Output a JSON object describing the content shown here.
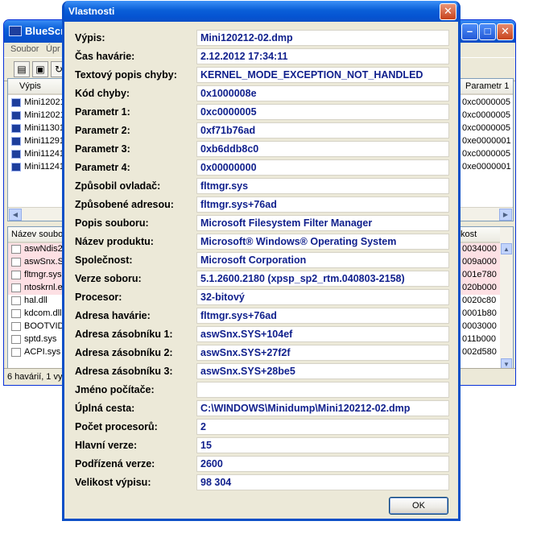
{
  "background_window": {
    "title": "BlueScr",
    "menu": [
      "Soubor",
      "Úpr"
    ],
    "top_list": {
      "header_left": "Výpis",
      "header_right": "Parametr 1",
      "rows": [
        {
          "name": "Mini12021",
          "param": "0xc0000005"
        },
        {
          "name": "Mini12021",
          "param": "0xc0000005"
        },
        {
          "name": "Mini11301",
          "param": "0xc0000005"
        },
        {
          "name": "Mini11291",
          "param": "0xe0000001"
        },
        {
          "name": "Mini11241",
          "param": "0xc0000005"
        },
        {
          "name": "Mini11241",
          "param": "0xe0000001"
        }
      ]
    },
    "bottom_list": {
      "header_left": "Název soubo",
      "header_right": "kost",
      "rows": [
        {
          "name": "aswNdis2",
          "addr": "0034000",
          "highlight": true
        },
        {
          "name": "aswSnx.S",
          "addr": "009a000",
          "highlight": true
        },
        {
          "name": "fltmgr.sys",
          "addr": "001e780",
          "highlight": true
        },
        {
          "name": "ntoskrnl.e",
          "addr": "020b000",
          "highlight": true
        },
        {
          "name": "hal.dll",
          "addr": "0020c80",
          "highlight": false
        },
        {
          "name": "kdcom.dll",
          "addr": "0001b80",
          "highlight": false
        },
        {
          "name": "BOOTVID",
          "addr": "0003000",
          "highlight": false
        },
        {
          "name": "sptd.sys",
          "addr": "011b000",
          "highlight": false
        },
        {
          "name": "ACPI.sys",
          "addr": "002d580",
          "highlight": false
        }
      ]
    },
    "status_text": "6 havárií, 1 vy"
  },
  "dialog": {
    "title": "Vlastnosti",
    "close_glyph": "✕",
    "ok_label": "OK",
    "properties": [
      {
        "label": "Výpis:",
        "value": "Mini120212-02.dmp"
      },
      {
        "label": "Čas havárie:",
        "value": "2.12.2012 17:34:11"
      },
      {
        "label": "Textový popis chyby:",
        "value": "KERNEL_MODE_EXCEPTION_NOT_HANDLED"
      },
      {
        "label": "Kód chyby:",
        "value": "0x1000008e"
      },
      {
        "label": "Parametr 1:",
        "value": "0xc0000005"
      },
      {
        "label": "Parametr 2:",
        "value": "0xf71b76ad"
      },
      {
        "label": "Parametr 3:",
        "value": "0xb6ddb8c0"
      },
      {
        "label": "Parametr 4:",
        "value": "0x00000000"
      },
      {
        "label": "Způsobil ovladač:",
        "value": "fltmgr.sys"
      },
      {
        "label": "Způsobené adresou:",
        "value": "fltmgr.sys+76ad"
      },
      {
        "label": "Popis souboru:",
        "value": "Microsoft Filesystem Filter Manager"
      },
      {
        "label": "Název produktu:",
        "value": "Microsoft® Windows® Operating System"
      },
      {
        "label": "Společnost:",
        "value": "Microsoft Corporation"
      },
      {
        "label": "Verze soboru:",
        "value": "5.1.2600.2180 (xpsp_sp2_rtm.040803-2158)"
      },
      {
        "label": "Procesor:",
        "value": "32-bitový"
      },
      {
        "label": "Adresa havárie:",
        "value": "fltmgr.sys+76ad"
      },
      {
        "label": "Adresa zásobníku 1:",
        "value": "aswSnx.SYS+104ef"
      },
      {
        "label": "Adresa zásobníku 2:",
        "value": "aswSnx.SYS+27f2f"
      },
      {
        "label": "Adresa zásobníku 3:",
        "value": "aswSnx.SYS+28be5"
      },
      {
        "label": "Jméno počítače:",
        "value": ""
      },
      {
        "label": "Úplná cesta:",
        "value": "C:\\WINDOWS\\Minidump\\Mini120212-02.dmp"
      },
      {
        "label": "Počet procesorů:",
        "value": "2"
      },
      {
        "label": "Hlavní verze:",
        "value": "15"
      },
      {
        "label": "Podřízená verze:",
        "value": "2600"
      },
      {
        "label": "Velikost výpisu:",
        "value": "98 304"
      }
    ]
  }
}
